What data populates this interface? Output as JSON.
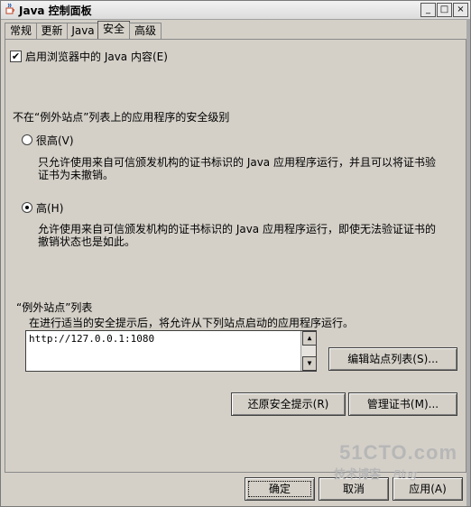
{
  "window": {
    "title": "Java 控制面板",
    "minimize": "_",
    "maximize": "□",
    "close": "×"
  },
  "tabs": [
    "常规",
    "更新",
    "Java",
    "安全",
    "高级"
  ],
  "active_tab": "安全",
  "browser_java": {
    "label": "启用浏览器中的 Java 内容(E)",
    "checked": true
  },
  "security_level": {
    "heading": "不在“例外站点”列表上的应用程序的安全级别",
    "options": [
      {
        "label": "很高(V)",
        "description": [
          "只允许使用来自可信颁发机构的证书标识的 Java 应用程序运行，并且可以将证书验",
          "证书为未撤销。"
        ],
        "selected": false
      },
      {
        "label": "高(H)",
        "description": [
          "允许使用来自可信颁发机构的证书标识的 Java 应用程序运行，即使无法验证证书的",
          "撤销状态也是如此。"
        ],
        "selected": true
      }
    ]
  },
  "exception_sites": {
    "heading": "“例外站点”列表",
    "description": "在进行适当的安全提示后，将允许从下列站点启动的应用程序运行。",
    "items": [
      "http://127.0.0.1:1080"
    ],
    "edit_button": "编辑站点列表(S)..."
  },
  "restore_button": "还原安全提示(R)",
  "certificates_button": "管理证书(M)...",
  "footer": {
    "ok": "确定",
    "cancel": "取消",
    "apply": "应用(A)"
  },
  "watermark": {
    "site": "51CTO.com",
    "sub": "技术博客",
    "blog": "Blog"
  }
}
